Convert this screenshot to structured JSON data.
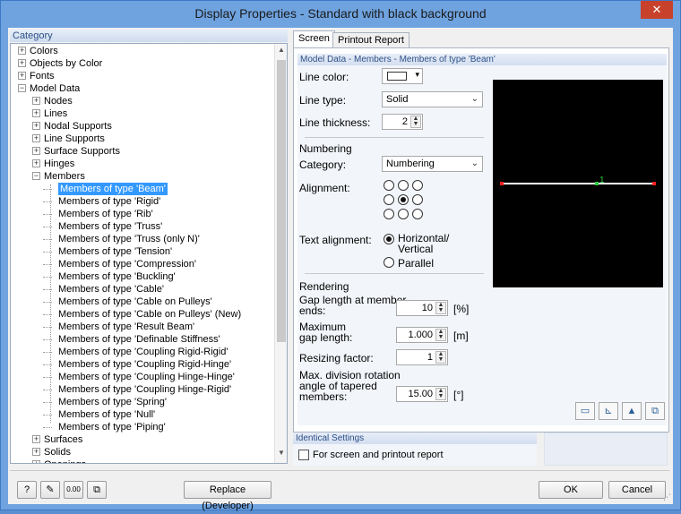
{
  "window": {
    "title": "Display Properties - Standard with black background",
    "close_icon": "close-icon"
  },
  "category": {
    "header": "Category",
    "items": [
      {
        "label": "Colors",
        "level": 0,
        "expander": "+"
      },
      {
        "label": "Objects by Color",
        "level": 0,
        "expander": "+"
      },
      {
        "label": "Fonts",
        "level": 0,
        "expander": "+"
      },
      {
        "label": "Model Data",
        "level": 0,
        "expander": "-"
      },
      {
        "label": "Nodes",
        "level": 1,
        "expander": "+"
      },
      {
        "label": "Lines",
        "level": 1,
        "expander": "+"
      },
      {
        "label": "Nodal Supports",
        "level": 1,
        "expander": "+"
      },
      {
        "label": "Line Supports",
        "level": 1,
        "expander": "+"
      },
      {
        "label": "Surface Supports",
        "level": 1,
        "expander": "+"
      },
      {
        "label": "Hinges",
        "level": 1,
        "expander": "+"
      },
      {
        "label": "Members",
        "level": 1,
        "expander": "-"
      },
      {
        "label": "Members of type 'Beam'",
        "level": 2,
        "selected": true
      },
      {
        "label": "Members of type 'Rigid'",
        "level": 2
      },
      {
        "label": "Members of type 'Rib'",
        "level": 2
      },
      {
        "label": "Members of type 'Truss'",
        "level": 2
      },
      {
        "label": "Members of type 'Truss (only N)'",
        "level": 2
      },
      {
        "label": "Members of type 'Tension'",
        "level": 2
      },
      {
        "label": "Members of type 'Compression'",
        "level": 2
      },
      {
        "label": "Members of type 'Buckling'",
        "level": 2
      },
      {
        "label": "Members of type 'Cable'",
        "level": 2
      },
      {
        "label": "Members of type 'Cable on Pulleys'",
        "level": 2
      },
      {
        "label": "Members of type 'Cable on Pulleys'  (New)",
        "level": 2
      },
      {
        "label": "Members of type 'Result Beam'",
        "level": 2
      },
      {
        "label": "Members of type 'Definable Stiffness'",
        "level": 2
      },
      {
        "label": "Members of type 'Coupling Rigid-Rigid'",
        "level": 2
      },
      {
        "label": "Members of type 'Coupling Rigid-Hinge'",
        "level": 2
      },
      {
        "label": "Members of type 'Coupling Hinge-Hinge'",
        "level": 2
      },
      {
        "label": "Members of type 'Coupling Hinge-Rigid'",
        "level": 2
      },
      {
        "label": "Members of type 'Spring'",
        "level": 2
      },
      {
        "label": "Members of type 'Null'",
        "level": 2
      },
      {
        "label": "Members of type 'Piping'",
        "level": 2
      },
      {
        "label": "Surfaces",
        "level": 1,
        "expander": "+"
      },
      {
        "label": "Solids",
        "level": 1,
        "expander": "+"
      },
      {
        "label": "Openings",
        "level": 1,
        "expander": "+"
      }
    ]
  },
  "tabs": {
    "screen": "Screen",
    "printout": "Printout Report"
  },
  "group": {
    "header": "Model Data - Members - Members of type 'Beam'",
    "line_color_label": "Line color:",
    "line_type_label": "Line type:",
    "line_type_value": "Solid",
    "line_thickness_label": "Line thickness:",
    "line_thickness_value": "2",
    "numbering_section": "Numbering",
    "category_label": "Category:",
    "category_value": "Numbering",
    "alignment_label": "Alignment:",
    "text_alignment_label": "Text alignment:",
    "horizontal_label": "Horizontal/",
    "vertical_label": "Vertical",
    "parallel_label": "Parallel",
    "rendering_section": "Rendering",
    "gap_length_label_1": "Gap length at member",
    "gap_length_label_2": "ends:",
    "gap_length_value": "10",
    "gap_length_unit": "[%]",
    "max_gap_label_1": "Maximum",
    "max_gap_label_2": "gap length:",
    "max_gap_value": "1.000",
    "max_gap_unit": "[m]",
    "resizing_label": "Resizing factor:",
    "resizing_value": "1",
    "max_div_label_1": "Max. division rotation",
    "max_div_label_2": "angle of tapered",
    "max_div_label_3": "members:",
    "max_div_value": "15.00",
    "max_div_unit": "[°]",
    "preview_member_number": "1",
    "line_color": "#ffffff",
    "preview_background": "#000000",
    "alignment_selected": "center"
  },
  "identical": {
    "header": "Identical Settings",
    "checkbox_label": "For screen and printout report",
    "checked": false
  },
  "footer": {
    "replace_button": "Replace (Developer)",
    "ok": "OK",
    "cancel": "Cancel",
    "number_icon_text": "0.00"
  }
}
